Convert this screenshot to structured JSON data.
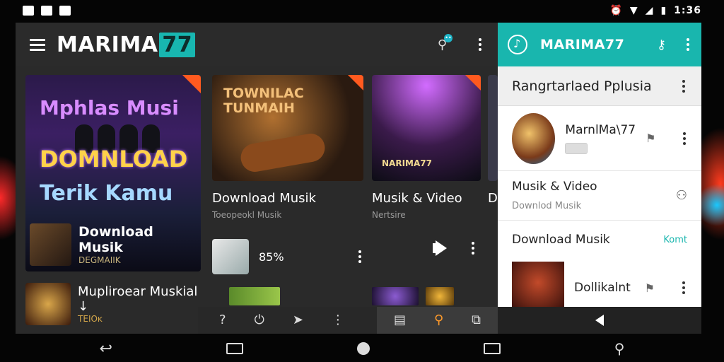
{
  "status_bar": {
    "time": "1:36",
    "icons": [
      "notification-icon",
      "image-icon",
      "app-icon",
      "alarm-icon",
      "wifi-icon",
      "signal-icon",
      "battery-icon"
    ]
  },
  "app": {
    "title_main": "MARIMA",
    "title_tail": "77",
    "search_badge": "••",
    "big_tile": {
      "line1": "Mphlas Musi",
      "line2": "DOMNLOAD",
      "line3": "Terik Kamu",
      "footer_title": "Download Musik",
      "footer_sub": "DEGMAIIK"
    },
    "cards": [
      {
        "art_title": "TOWNILAC TUNMAIH",
        "title": "Download Musik",
        "sub": "Toeopeokl Musik",
        "percent": "85%"
      },
      {
        "art_title": "NARIMA77",
        "title": "Musik & Video",
        "sub": "Nertsire"
      },
      {
        "title": "Da"
      }
    ],
    "bottom_item": {
      "title": "Mupliroear Muskial ↓",
      "sub": "TEIOĸ"
    },
    "bottom_nav_icons": [
      "help-icon",
      "power-icon",
      "fish-icon",
      "more-icon",
      "book-icon",
      "search-icon",
      "external-icon"
    ]
  },
  "panel": {
    "title": "MARIMA77",
    "section_label": "Rangrtarlaed Pplusia",
    "profile": {
      "name": "MarnlMa\\77"
    },
    "media": {
      "title": "Musik & Video",
      "sub": "Downlod Musik"
    },
    "download": {
      "label": "Download Musik",
      "link": "Komt"
    },
    "track": {
      "name": "Dollikalnt"
    }
  },
  "colors": {
    "accent": "#19b6ae",
    "orange": "#ff9a2a"
  }
}
